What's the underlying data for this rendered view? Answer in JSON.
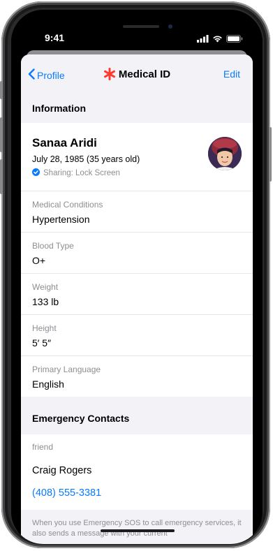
{
  "status_bar": {
    "time": "9:41"
  },
  "nav": {
    "back_label": "Profile",
    "title": "Medical ID",
    "edit_label": "Edit"
  },
  "information": {
    "header": "Information",
    "name": "Sanaa Aridi",
    "dob": "July 28, 1985 (35 years old)",
    "sharing": "Sharing: Lock Screen",
    "fields": [
      {
        "label": "Medical Conditions",
        "value": "Hypertension"
      },
      {
        "label": "Blood Type",
        "value": "O+"
      },
      {
        "label": "Weight",
        "value": "133 lb"
      },
      {
        "label": "Height",
        "value": "5′ 5″"
      },
      {
        "label": "Primary Language",
        "value": "English"
      }
    ]
  },
  "emergency": {
    "header": "Emergency Contacts",
    "relationship": "friend",
    "name": "Craig Rogers",
    "phone": "(408) 555-3381"
  },
  "footer": {
    "note": "When you use Emergency SOS to call emergency services, it also sends a message with your current"
  },
  "colors": {
    "accent": "#0a7aff",
    "medical_star": "#ff3b30",
    "background": "#f2f2f7"
  },
  "icons": [
    "back-chevron-icon",
    "medical-star-icon",
    "checkmark-badge-icon",
    "signal-icon",
    "wifi-icon",
    "battery-icon"
  ]
}
